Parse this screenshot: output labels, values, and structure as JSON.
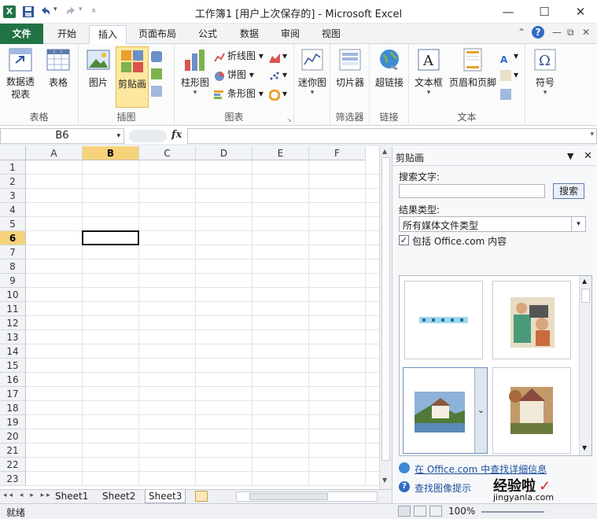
{
  "window": {
    "title": "工作簿1 [用户上次保存的] - Microsoft Excel",
    "minimize": "—",
    "maximize": "☐",
    "close": "✕"
  },
  "tabs": [
    "文件",
    "开始",
    "插入",
    "页面布局",
    "公式",
    "数据",
    "审阅",
    "视图"
  ],
  "active_tab": "插入",
  "ribbon": {
    "groups": {
      "tables": {
        "label": "表格",
        "pivot": "数据透视表",
        "table": "表格"
      },
      "illustrations": {
        "label": "插图",
        "picture": "图片",
        "clipart": "剪贴画"
      },
      "charts": {
        "label": "图表",
        "column": "柱形图",
        "line": "折线图",
        "pie": "饼图",
        "bar": "条形图"
      },
      "sparklines": {
        "label": "",
        "sparkline": "迷你图"
      },
      "filter": {
        "label": "筛选器",
        "slicer": "切片器"
      },
      "links": {
        "label": "链接",
        "hyperlink": "超链接"
      },
      "text": {
        "label": "文本",
        "textbox": "文本框",
        "header_footer": "页眉和页脚"
      },
      "symbols": {
        "label": "",
        "symbol": "符号"
      }
    }
  },
  "formula_bar": {
    "name_box": "B6",
    "fx": "fx",
    "formula": ""
  },
  "sheet": {
    "columns": [
      "A",
      "B",
      "C",
      "D",
      "E",
      "F"
    ],
    "rows": [
      "1",
      "2",
      "3",
      "4",
      "5",
      "6",
      "7",
      "8",
      "9",
      "10",
      "11",
      "12",
      "13",
      "14",
      "15",
      "16",
      "17",
      "18",
      "19",
      "20",
      "21",
      "22",
      "23"
    ],
    "selected_col": "B",
    "selected_row": "6"
  },
  "sheet_tabs": [
    "Sheet1",
    "Sheet2",
    "Sheet3"
  ],
  "active_sheet": "Sheet3",
  "status": {
    "ready": "就绪",
    "zoom": "100%"
  },
  "clipart_pane": {
    "title": "剪贴画",
    "search_label": "搜索文字:",
    "search_value": "",
    "search_button": "搜索",
    "result_type_label": "结果类型:",
    "result_type_value": "所有媒体文件类型",
    "include_office_label": "包括 Office.com 内容",
    "include_office_checked": true,
    "link_more": "在 Office.com 中查找详细信息",
    "link_tips": "查找图像提示"
  },
  "watermark": {
    "text": "经验啦",
    "url": "jingyanla.com"
  },
  "colors": {
    "excel_green": "#217346",
    "highlight": "#fde8a0",
    "link": "#1a4f9c"
  }
}
